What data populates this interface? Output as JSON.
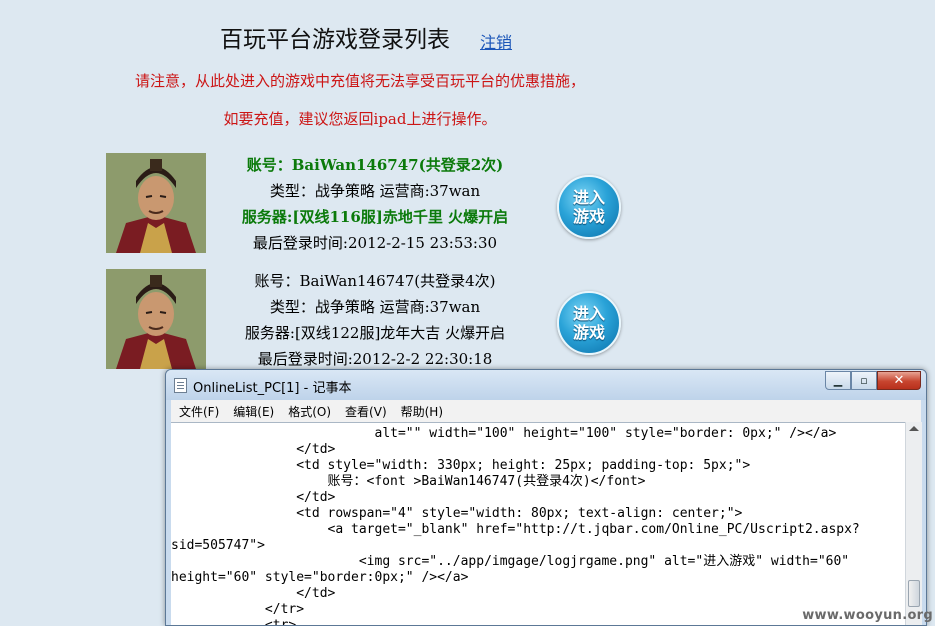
{
  "header": {
    "title": "百玩平台游戏登录列表",
    "logout": "注销"
  },
  "notices": [
    "请注意，从此处进入的游戏中充值将无法享受百玩平台的优惠措施，",
    "如要充值，建议您返回ipad上进行操作。"
  ],
  "accounts": [
    {
      "account": "账号：BaiWan146747(共登录2次)",
      "type": "类型：战争策略  运营商:37wan",
      "server": "服务器:[双线116服]赤地千里  火爆开启",
      "last_login": "最后登录时间:2012-2-15 23:53:30",
      "enter_label_1": "进入",
      "enter_label_2": "游戏"
    },
    {
      "account": "账号：BaiWan146747(共登录4次)",
      "type": "类型：战争策略  运营商:37wan",
      "server": "服务器:[双线122服]龙年大吉  火爆开启",
      "last_login": "最后登录时间:2012-2-2 22:30:18",
      "enter_label_1": "进入",
      "enter_label_2": "游戏"
    }
  ],
  "notepad": {
    "title": "OnlineList_PC[1] - 记事本",
    "minimize": "▁",
    "maximize": "▫",
    "close": "✕",
    "menu": [
      "文件(F)",
      "编辑(E)",
      "格式(O)",
      "查看(V)",
      "帮助(H)"
    ],
    "lines": [
      "                          alt=\"\" width=\"100\" height=\"100\" style=\"border: 0px;\" /></a>",
      "                </td>",
      "                <td style=\"width: 330px; height: 25px; padding-top: 5px;\">",
      "                    账号：<font >BaiWan146747(共登录4次)</font>",
      "                </td>",
      "                <td rowspan=\"4\" style=\"width: 80px; text-align: center;\">",
      "                    <a target=\"_blank\" href=\"http://t.jqbar.com/Online_PC/Uscript2.aspx?",
      "sid=505747\">",
      "                        <img src=\"../app/imgage/logjrgame.png\" alt=\"进入游戏\" width=\"60\"",
      "height=\"60\" style=\"border:0px;\" /></a>",
      "                </td>",
      "            </tr>",
      "            <tr>"
    ]
  },
  "watermark": "www.wooyun.org"
}
